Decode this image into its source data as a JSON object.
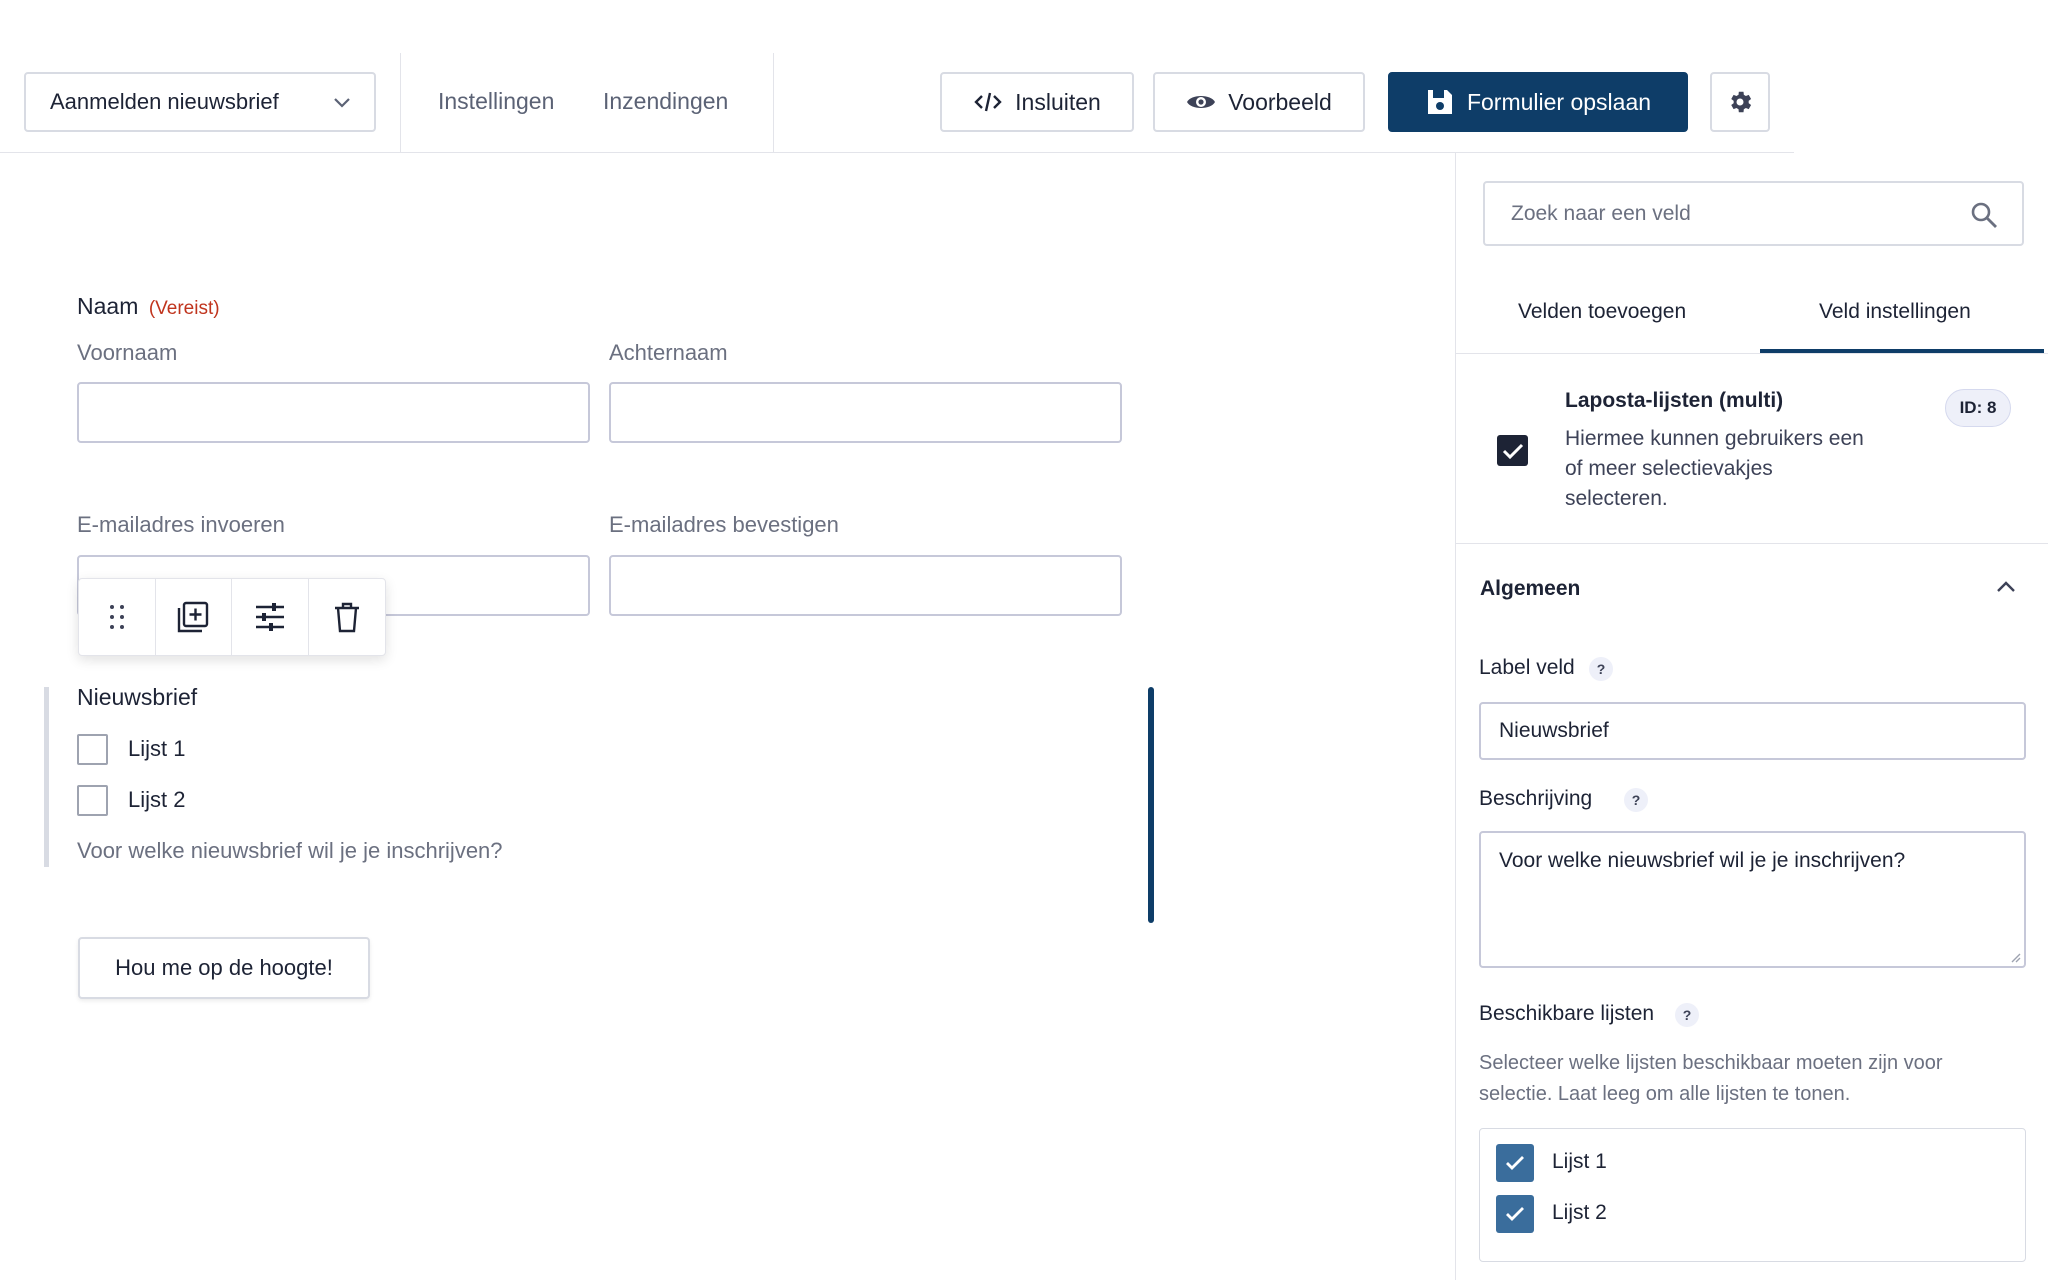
{
  "toolbar": {
    "form_select": "Aanmelden nieuwsbrief",
    "nav": [
      "Instellingen",
      "Inzendingen"
    ],
    "embed_label": "Insluiten",
    "preview_label": "Voorbeeld",
    "save_label": "Formulier opslaan"
  },
  "form": {
    "name_field": {
      "label": "Naam",
      "required": "(Vereist)",
      "first": "Voornaam",
      "last": "Achternaam"
    },
    "email_field": {
      "enter": "E-mailadres invoeren",
      "confirm": "E-mailadres bevestigen"
    },
    "newsletter": {
      "label": "Nieuwsbrief",
      "options": [
        "Lijst 1",
        "Lijst 2"
      ],
      "description": "Voor welke nieuwsbrief wil je je inschrijven?"
    },
    "submit_label": "Hou me op de hoogte!"
  },
  "sidebar": {
    "search_placeholder": "Zoek naar een veld",
    "tabs": [
      "Velden toevoegen",
      "Veld instellingen"
    ],
    "active_tab": "Veld instellingen",
    "field_type": {
      "title": "Laposta-lijsten (multi)",
      "description_lines": [
        "Hiermee kunnen gebruikers een",
        "of meer selectievakjes",
        "selecteren."
      ],
      "id_badge": "ID: 8"
    },
    "section_title": "Algemeen",
    "help_glyph": "?",
    "label_field": {
      "label": "Label veld",
      "value": "Nieuwsbrief"
    },
    "description_field": {
      "label": "Beschrijving",
      "value": "Voor welke nieuwsbrief wil je je inschrijven?"
    },
    "lists_field": {
      "label": "Beschikbare lijsten",
      "help_lines": [
        "Selecteer welke lijsten beschikbaar moeten zijn voor",
        "selectie. Laat leeg om alle lijsten te tonen."
      ],
      "options": [
        "Lijst 1",
        "Lijst 2"
      ]
    }
  },
  "colors": {
    "primary": "#0e3d68",
    "required": "#c0341d",
    "checkbox_blue": "#3a6d9c"
  }
}
